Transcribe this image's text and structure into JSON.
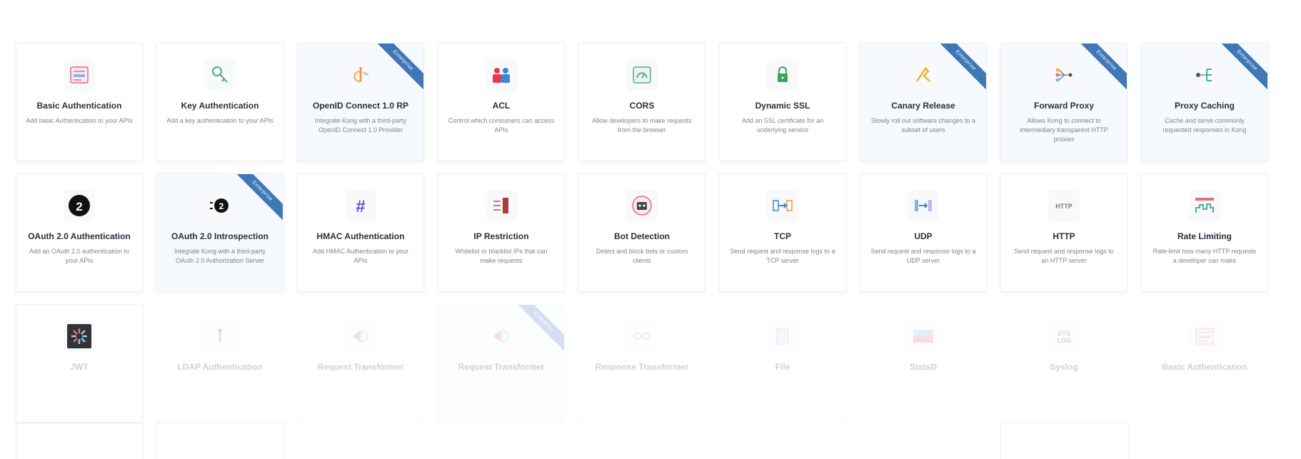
{
  "ribbon_label": "Enterprise",
  "colors": {
    "ribbon": "#3f77b8",
    "enterprise_card": "#f6f9fe",
    "title": "#2a2f3a",
    "desc": "#7b8494"
  },
  "plugins": [
    {
      "title": "Basic Authentication",
      "desc": "Add basic Authentication to your APIs",
      "icon": "basic-auth-icon",
      "enterprise": false,
      "faded": false
    },
    {
      "title": "Key Authentication",
      "desc": "Add a key authentication to your APIs",
      "icon": "key-icon",
      "enterprise": false,
      "faded": false
    },
    {
      "title": "OpenID Connect 1.0 RP",
      "desc": "Integrate Kong with a third-party OpenID Connect 1.0 Provider",
      "icon": "openid-icon",
      "enterprise": true,
      "faded": false
    },
    {
      "title": "ACL",
      "desc": "Control which consumers can access APIs",
      "icon": "users-icon",
      "enterprise": false,
      "faded": false
    },
    {
      "title": "CORS",
      "desc": "Allow developers to make requests from the browser",
      "icon": "cors-icon",
      "enterprise": false,
      "faded": false
    },
    {
      "title": "Dynamic SSL",
      "desc": "Add an SSL certificate for an underlying service",
      "icon": "lock-icon",
      "enterprise": false,
      "faded": false
    },
    {
      "title": "Canary Release",
      "desc": "Slowly roll out software changes to a subset of users",
      "icon": "canary-icon",
      "enterprise": true,
      "faded": false
    },
    {
      "title": "Forward Proxy",
      "desc": "Allows Kong to connect to intermediary transparent HTTP proxies",
      "icon": "forward-proxy-icon",
      "enterprise": true,
      "faded": false
    },
    {
      "title": "Proxy Caching",
      "desc": "Cache and serve commonly requested responses in Kong",
      "icon": "proxy-caching-icon",
      "enterprise": true,
      "faded": false
    },
    {
      "title": "OAuth 2.0 Authentication",
      "desc": "Add an OAuth 2.0 authentication to your APIs",
      "icon": "oauth-icon",
      "enterprise": false,
      "faded": false
    },
    {
      "title": "OAuth 2.0 Introspection",
      "desc": "Integrate Kong with a third-party OAuth 2.0 Authorization Server",
      "icon": "oauth-introspection-icon",
      "enterprise": true,
      "faded": false
    },
    {
      "title": "HMAC Authentication",
      "desc": "Add HMAC Authentication to your APIs",
      "icon": "hash-icon",
      "enterprise": false,
      "faded": false
    },
    {
      "title": "IP Restriction",
      "desc": "Whitelist or blacklist IPs that can make requests",
      "icon": "ip-restriction-icon",
      "enterprise": false,
      "faded": false
    },
    {
      "title": "Bot Detection",
      "desc": "Detect and block bots or custom clients",
      "icon": "bot-icon",
      "enterprise": false,
      "faded": false
    },
    {
      "title": "TCP",
      "desc": "Send request and response logs to a TCP server",
      "icon": "tcp-icon",
      "enterprise": false,
      "faded": false
    },
    {
      "title": "UDP",
      "desc": "Send request and response logs to a UDP server",
      "icon": "udp-icon",
      "enterprise": false,
      "faded": false
    },
    {
      "title": "HTTP",
      "desc": "Send request and response logs to an HTTP server",
      "icon": "http-icon",
      "enterprise": false,
      "faded": false
    },
    {
      "title": "Rate Limiting",
      "desc": "Rate-limit how many HTTP requests a developer can make",
      "icon": "rate-limit-icon",
      "enterprise": false,
      "faded": false
    },
    {
      "title": "JWT",
      "desc": "",
      "icon": "jwt-icon",
      "enterprise": false,
      "faded": true,
      "strong_icon": true
    },
    {
      "title": "LDAP Authentication",
      "desc": "",
      "icon": "ldap-icon",
      "enterprise": false,
      "faded": true
    },
    {
      "title": "Request Transformer",
      "desc": "",
      "icon": "transformer-icon",
      "enterprise": false,
      "faded": true
    },
    {
      "title": "Request Transformer",
      "desc": "",
      "icon": "transformer-icon",
      "enterprise": true,
      "faded": true
    },
    {
      "title": "Response Transformer",
      "desc": "",
      "icon": "response-transformer-icon",
      "enterprise": false,
      "faded": true
    },
    {
      "title": "File",
      "desc": "",
      "icon": "file-icon",
      "enterprise": false,
      "faded": true
    },
    {
      "title": "StatsD",
      "desc": "",
      "icon": "statsd-icon",
      "enterprise": false,
      "faded": true
    },
    {
      "title": "Syslog",
      "desc": "",
      "icon": "syslog-icon",
      "enterprise": false,
      "faded": true
    },
    {
      "title": "Basic Authentication",
      "desc": "",
      "icon": "basic-auth-icon",
      "enterprise": false,
      "faded": true
    }
  ]
}
